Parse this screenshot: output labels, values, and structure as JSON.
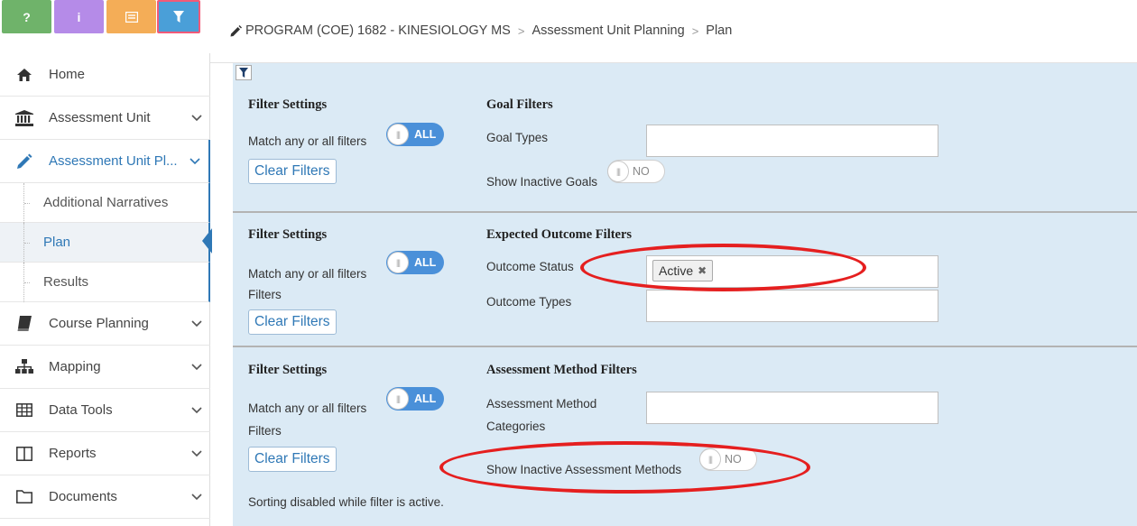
{
  "toolbar": {
    "help_label": "?",
    "info_label": "i"
  },
  "sidebar": {
    "items": [
      {
        "label": "Home",
        "icon": "home-icon"
      },
      {
        "label": "Assessment Unit",
        "icon": "institution-icon"
      },
      {
        "label": "Assessment Unit Pl...",
        "icon": "pencil-icon"
      },
      {
        "label": "Course Planning",
        "icon": "book-icon"
      },
      {
        "label": "Mapping",
        "icon": "sitemap-icon"
      },
      {
        "label": "Data Tools",
        "icon": "table-icon"
      },
      {
        "label": "Reports",
        "icon": "columns-icon"
      },
      {
        "label": "Documents",
        "icon": "folder-icon"
      }
    ],
    "sub_items": [
      {
        "label": "Additional Narratives"
      },
      {
        "label": "Plan"
      },
      {
        "label": "Results"
      }
    ]
  },
  "breadcrumb": {
    "program": "PROGRAM (COE) 1682 - KINESIOLOGY MS",
    "step": "Assessment Unit Planning",
    "page": "Plan",
    "separator": ">"
  },
  "sections": {
    "goal": {
      "settings_title": "Filter Settings",
      "match_label": "Match any or all filters",
      "match_toggle": "ALL",
      "clear_label": "Clear Filters",
      "filters_title": "Goal Filters",
      "goal_types_label": "Goal Types",
      "show_inactive_label": "Show Inactive Goals",
      "show_inactive_toggle": "NO"
    },
    "outcome": {
      "settings_title": "Filter Settings",
      "match_label": "Match any or all filters",
      "match_suffix": "Filters",
      "match_toggle": "ALL",
      "clear_label": "Clear Filters",
      "filters_title": "Expected Outcome Filters",
      "status_label": "Outcome Status",
      "status_tag": "Active",
      "types_label": "Outcome Types"
    },
    "method": {
      "settings_title": "Filter Settings",
      "match_label": "Match any or all filters",
      "match_suffix": "Filters",
      "match_toggle": "ALL",
      "clear_label": "Clear Filters",
      "filters_title": "Assessment Method Filters",
      "categories_label_1": "Assessment Method",
      "categories_label_2": "Categories",
      "show_inactive_label": "Show Inactive Assessment Methods",
      "show_inactive_toggle": "NO"
    }
  },
  "sorting_note": "Sorting disabled while filter is active.",
  "colors": {
    "accent": "#2f78b6",
    "panel_bg": "#dbeaf5",
    "highlight": "#e51f1f"
  }
}
